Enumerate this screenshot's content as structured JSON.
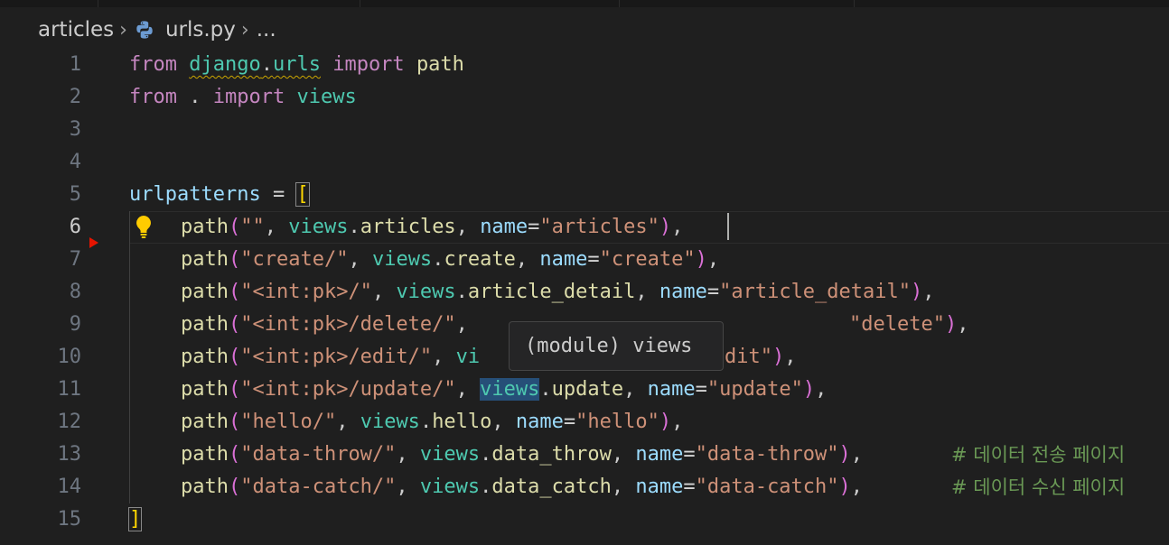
{
  "breadcrumb": {
    "folder": "articles",
    "file": "urls.py",
    "more": "..."
  },
  "editor": {
    "active_line": 6,
    "line_numbers": [
      "1",
      "2",
      "3",
      "4",
      "5",
      "6",
      "7",
      "8",
      "9",
      "10",
      "11",
      "12",
      "13",
      "14",
      "15"
    ],
    "hover_tooltip": "(module) views"
  },
  "tokens": {
    "from": "from",
    "import": "import",
    "django": "django",
    "dot": ".",
    "urls": "urls",
    "path": "path",
    "views": "views",
    "urlpatterns": "urlpatterns",
    "eq": " = ",
    "lbracket": "[",
    "rbracket": "]",
    "lparen": "(",
    "rparen": ")",
    "comma": ", ",
    "comma_end": ",",
    "name": "name",
    "assign": "=",
    "s_empty": "\"\"",
    "s_articles": "\"articles\"",
    "s_create_url": "\"create/\"",
    "s_create": "\"create\"",
    "s_detail_url": "\"<int:pk>/\"",
    "s_detail": "\"article_detail\"",
    "s_delete_url": "\"<int:pk>/delete/\"",
    "s_delete": "\"delete\"",
    "s_edit_url": "\"<int:pk>/edit/\"",
    "s_edit_visible": "dit\"",
    "s_update_url": "\"<int:pk>/update/\"",
    "s_update": "\"update\"",
    "s_hello_url": "\"hello/\"",
    "s_hello": "\"hello\"",
    "s_throw_url": "\"data-throw/\"",
    "s_throw": "\"data-throw\"",
    "s_catch_url": "\"data-catch/\"",
    "s_catch": "\"data-catch\"",
    "articles": "articles",
    "create": "create",
    "article_detail": "article_detail",
    "update": "update",
    "hello": "hello",
    "data_throw": "data_throw",
    "data_catch": "data_catch",
    "vi": "vi",
    "comment_throw": "# 데이터 전송 페이지",
    "comment_catch": "# 데이터 수신 페이지"
  },
  "colors": {
    "background": "#1f1f1f",
    "keyword": "#c586c0",
    "module": "#4ec9b0",
    "function": "#dcdcaa",
    "variable": "#9cdcfe",
    "string": "#ce9178",
    "comment": "#6a9955",
    "bracket": "#ffd700"
  },
  "icons": {
    "file_icon": "python-icon",
    "lightbulb": "lightbulb-icon",
    "chevron": "chevron-right-icon",
    "breakpoint_marker": "triangle-marker-icon"
  }
}
